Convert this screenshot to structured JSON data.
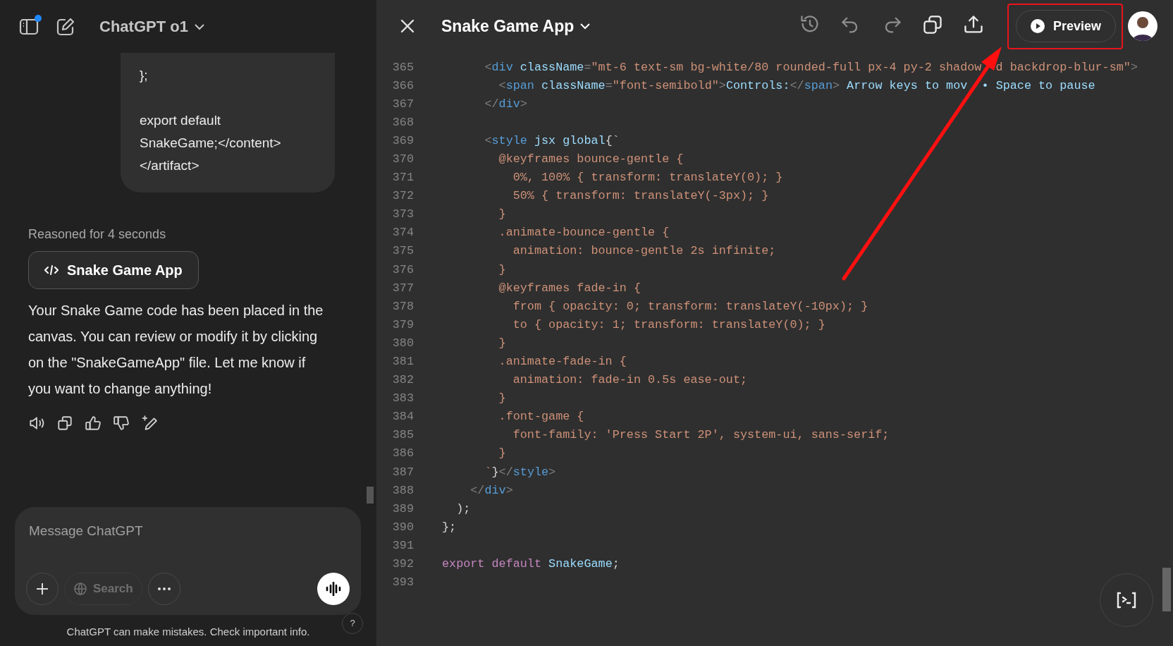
{
  "chat": {
    "model": "ChatGPT o1",
    "new_chat_badge": true,
    "user_message": "};\n\nexport default\nSnakeGame;</content>\n</artifact>",
    "reasoning": "Reasoned for 4 seconds",
    "artifact_button": "Snake Game App",
    "reply": "Your Snake Game code has been placed in the canvas. You can review or modify it by clicking on the \"SnakeGameApp\" file. Let me know if you want to change anything!",
    "actions": [
      {
        "kind": "speaker"
      },
      {
        "kind": "copy"
      },
      {
        "kind": "like"
      },
      {
        "kind": "dislike"
      },
      {
        "kind": "edit"
      }
    ],
    "composer": {
      "placeholder": "Message ChatGPT",
      "search": {
        "label": "Search",
        "disabled": true
      }
    },
    "disclaimer": "ChatGPT can make mistakes. Check important info.",
    "help": "?"
  },
  "canvas": {
    "title": "Snake Game App",
    "toolbar": [
      {
        "kind": "history",
        "disabled": true
      },
      {
        "kind": "undo",
        "disabled": true
      },
      {
        "kind": "redo",
        "disabled": true
      },
      {
        "kind": "copy",
        "disabled": false
      },
      {
        "kind": "share",
        "disabled": false
      }
    ],
    "preview_button": "Preview",
    "lines": [
      {
        "number": "365",
        "tokens": [
          {
            "kind": "punct",
            "text": "      <"
          },
          {
            "kind": "tag",
            "text": "div"
          },
          {
            "kind": "attr",
            "text": " className"
          },
          {
            "kind": "punct",
            "text": "="
          },
          {
            "kind": "string",
            "text": "\"mt-6 text-sm bg-white/80 rounded-full px-4 py-2 shadow"
          },
          {
            "kind": "string",
            "text": "d backdrop-blur-sm\"",
            "gap_before": true
          },
          {
            "kind": "punct",
            "text": ">"
          }
        ]
      },
      {
        "number": "366",
        "tokens": [
          {
            "kind": "punct",
            "text": "        <"
          },
          {
            "kind": "tag",
            "text": "span"
          },
          {
            "kind": "attr",
            "text": " className"
          },
          {
            "kind": "punct",
            "text": "="
          },
          {
            "kind": "string",
            "text": "\"font-semibold\""
          },
          {
            "kind": "punct",
            "text": ">"
          },
          {
            "kind": "attr",
            "text": "Controls:"
          },
          {
            "kind": "punct",
            "text": "</"
          },
          {
            "kind": "tag",
            "text": "span"
          },
          {
            "kind": "punct",
            "text": ">"
          },
          {
            "kind": "attr",
            "text": " Arrow keys to mov"
          },
          {
            "kind": "attr",
            "text": "• Space to pause",
            "gap_before": true
          }
        ]
      },
      {
        "number": "367",
        "tokens": [
          {
            "kind": "punct",
            "text": "      </"
          },
          {
            "kind": "tag",
            "text": "div"
          },
          {
            "kind": "punct",
            "text": ">"
          }
        ]
      },
      {
        "number": "368"
      },
      {
        "number": "369",
        "tokens": [
          {
            "kind": "punct",
            "text": "      <"
          },
          {
            "kind": "tag",
            "text": "style"
          },
          {
            "kind": "attr",
            "text": " jsx global"
          },
          {
            "kind": "plain",
            "text": "{`"
          }
        ]
      },
      {
        "number": "370",
        "tokens": [
          {
            "kind": "string",
            "text": "        @keyframes bounce-gentle {"
          }
        ]
      },
      {
        "number": "371",
        "tokens": [
          {
            "kind": "string",
            "text": "          0%, 100% { transform: translateY(0); }"
          }
        ]
      },
      {
        "number": "372",
        "tokens": [
          {
            "kind": "string",
            "text": "          50% { transform: translateY(-3px); }"
          }
        ]
      },
      {
        "number": "373",
        "tokens": [
          {
            "kind": "string",
            "text": "        }"
          }
        ]
      },
      {
        "number": "374",
        "tokens": [
          {
            "kind": "string",
            "text": "        .animate-bounce-gentle {"
          }
        ]
      },
      {
        "number": "375",
        "tokens": [
          {
            "kind": "string",
            "text": "          animation: bounce-gentle 2s infinite;"
          }
        ]
      },
      {
        "number": "376",
        "tokens": [
          {
            "kind": "string",
            "text": "        }"
          }
        ]
      },
      {
        "number": "377",
        "tokens": [
          {
            "kind": "string",
            "text": "        @keyframes fade-in {"
          }
        ]
      },
      {
        "number": "378",
        "tokens": [
          {
            "kind": "string",
            "text": "          from { opacity: 0; transform: translateY(-10px); }"
          }
        ]
      },
      {
        "number": "379",
        "tokens": [
          {
            "kind": "string",
            "text": "          to { opacity: 1; transform: translateY(0); }"
          }
        ]
      },
      {
        "number": "380",
        "tokens": [
          {
            "kind": "string",
            "text": "        }"
          }
        ]
      },
      {
        "number": "381",
        "tokens": [
          {
            "kind": "string",
            "text": "        .animate-fade-in {"
          }
        ]
      },
      {
        "number": "382",
        "tokens": [
          {
            "kind": "string",
            "text": "          animation: fade-in 0.5s ease-out;"
          }
        ]
      },
      {
        "number": "383",
        "tokens": [
          {
            "kind": "string",
            "text": "        }"
          }
        ]
      },
      {
        "number": "384",
        "tokens": [
          {
            "kind": "string",
            "text": "        .font-game {"
          }
        ]
      },
      {
        "number": "385",
        "tokens": [
          {
            "kind": "string",
            "text": "          font-family: 'Press Start 2P', system-ui, sans-serif;"
          }
        ]
      },
      {
        "number": "386",
        "tokens": [
          {
            "kind": "string",
            "text": "        }"
          }
        ]
      },
      {
        "number": "387",
        "tokens": [
          {
            "kind": "string",
            "text": "      `"
          },
          {
            "kind": "plain",
            "text": "}"
          },
          {
            "kind": "punct",
            "text": "</"
          },
          {
            "kind": "tag",
            "text": "style"
          },
          {
            "kind": "punct",
            "text": ">"
          }
        ]
      },
      {
        "number": "388",
        "tokens": [
          {
            "kind": "punct",
            "text": "    </"
          },
          {
            "kind": "tag",
            "text": "div"
          },
          {
            "kind": "punct",
            "text": ">"
          }
        ]
      },
      {
        "number": "389",
        "tokens": [
          {
            "kind": "plain",
            "text": "  );"
          }
        ]
      },
      {
        "number": "390",
        "tokens": [
          {
            "kind": "plain",
            "text": "};"
          }
        ]
      },
      {
        "number": "391"
      },
      {
        "number": "392",
        "tokens": [
          {
            "kind": "keyword",
            "text": "export default"
          },
          {
            "kind": "attr",
            "text": " SnakeGame"
          },
          {
            "kind": "plain",
            "text": ";"
          }
        ]
      },
      {
        "number": "393"
      }
    ]
  },
  "annotations": {
    "highlight_box": true,
    "arrow": true
  }
}
